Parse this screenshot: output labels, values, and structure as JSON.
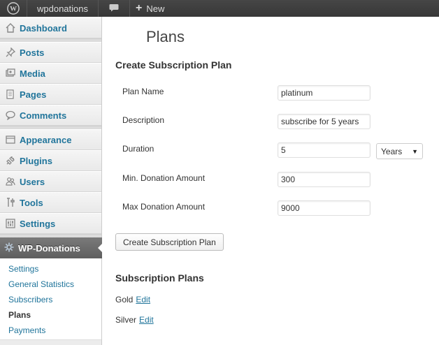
{
  "adminbar": {
    "site_name": "wpdonations",
    "new_label": "New"
  },
  "sidebar": {
    "items": [
      {
        "label": "Dashboard",
        "icon": "dashboard-icon"
      },
      {
        "label": "Posts",
        "icon": "pin-icon"
      },
      {
        "label": "Media",
        "icon": "media-icon"
      },
      {
        "label": "Pages",
        "icon": "pages-icon"
      },
      {
        "label": "Comments",
        "icon": "comment-icon"
      },
      {
        "label": "Appearance",
        "icon": "appearance-icon"
      },
      {
        "label": "Plugins",
        "icon": "plugin-icon"
      },
      {
        "label": "Users",
        "icon": "users-icon"
      },
      {
        "label": "Tools",
        "icon": "tools-icon"
      },
      {
        "label": "Settings",
        "icon": "settings-icon"
      }
    ],
    "active": {
      "label": "WP-Donations",
      "icon": "gear-icon"
    },
    "submenu": [
      "Settings",
      "General Statistics",
      "Subscribers",
      "Plans",
      "Payments"
    ],
    "current_submenu": "Plans"
  },
  "main": {
    "page_title": "Plans",
    "create_heading": "Create Subscription Plan",
    "fields": {
      "plan_name": {
        "label": "Plan Name",
        "value": "platinum"
      },
      "description": {
        "label": "Description",
        "value": "subscribe for 5 years"
      },
      "duration": {
        "label": "Duration",
        "value": "5",
        "unit": "Years"
      },
      "min_amount": {
        "label": "Min. Donation Amount",
        "value": "300"
      },
      "max_amount": {
        "label": "Max Donation Amount",
        "value": "9000"
      }
    },
    "submit_label": "Create Subscription Plan",
    "plans_heading": "Subscription Plans",
    "plans": [
      {
        "name": "Gold",
        "edit": "Edit"
      },
      {
        "name": "Silver",
        "edit": "Edit"
      }
    ]
  },
  "colors": {
    "link": "#21759b",
    "adminbar": "#464646",
    "active_menu": "#6d6d6d"
  }
}
